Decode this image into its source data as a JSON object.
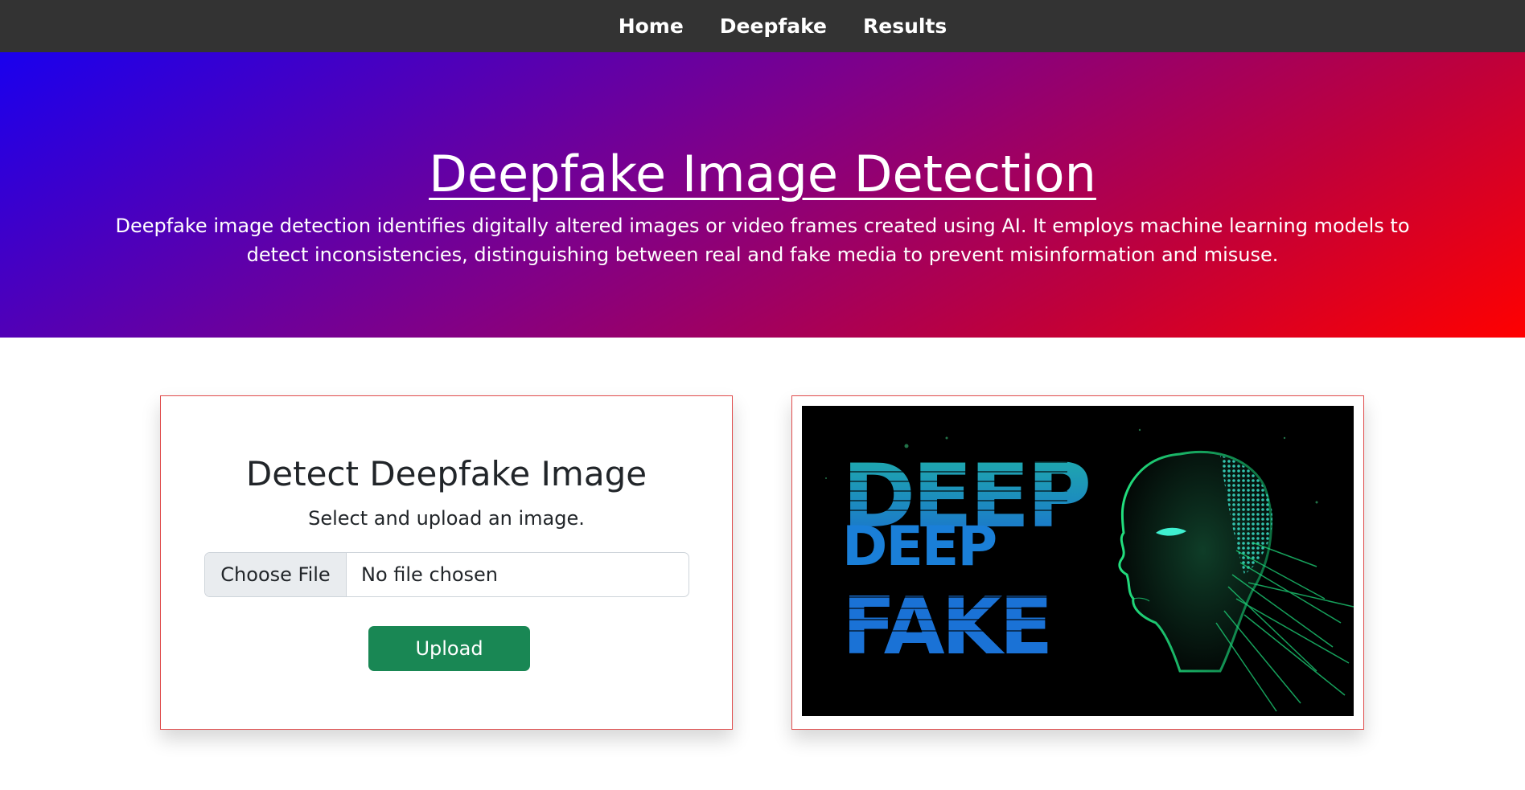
{
  "nav": {
    "items": [
      "Home",
      "Deepfake",
      "Results"
    ]
  },
  "hero": {
    "title": "Deepfake Image Detection",
    "description": "Deepfake image detection identifies digitally altered images or video frames created using AI. It employs machine learning models to detect inconsistencies, distinguishing between real and fake media to prevent misinformation and misuse."
  },
  "detect_card": {
    "title": "Detect Deepfake Image",
    "subtitle": "Select and upload an image.",
    "file_button_label": "Choose File",
    "file_status": "No file chosen",
    "upload_label": "Upload"
  },
  "illustration": {
    "text_lines": [
      "DEEP",
      "DEEP",
      "FAKE"
    ]
  },
  "colors": {
    "navbar": "#333333",
    "gradient_start": "#1a00ee",
    "gradient_end": "#ff0000",
    "card_border": "#e04b4b",
    "upload_button": "#198754",
    "art_text_top": "#1fb0a8",
    "art_text_bottom": "#1a6fd0",
    "art_face": "#1ed67a"
  }
}
